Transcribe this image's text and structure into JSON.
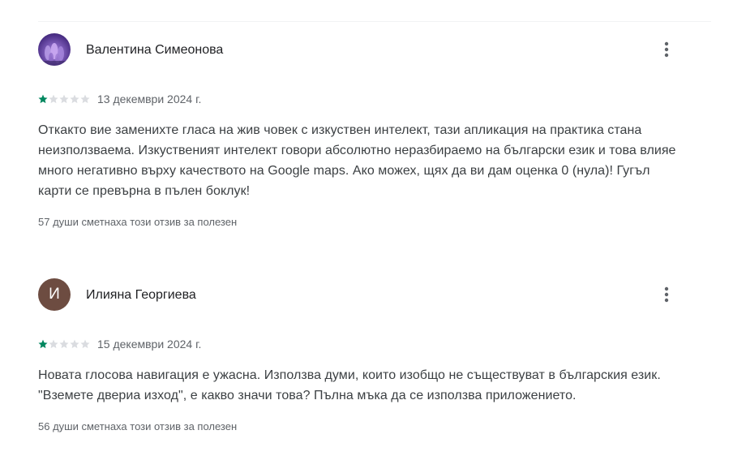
{
  "reviews": [
    {
      "author": "Валентина Симеонова",
      "avatar_type": "photo",
      "rating": 1,
      "max_rating": 5,
      "date": "13 декември 2024 г.",
      "text": "Откакто вие заменихте гласа на жив човек с изкуствен интелект, тази апликация на практика стана неизползваема. Изкуственият интелект говори абсолютно неразбираемо на български език и това влияе много негативно върху качеството на Google maps. Ако можех, щях да ви дам оценка 0 (нула)! Гугъл карти се превърна в пълен боклук!",
      "helpful": "57 души сметнаха този отзив за полезен"
    },
    {
      "author": "Илияна Георгиева",
      "avatar_type": "letter",
      "avatar_letter": "И",
      "rating": 1,
      "max_rating": 5,
      "date": "15 декември 2024 г.",
      "text": "Новата глосова навигация е ужасна. Използва думи, които изобщо не съществуват в българския език. \"Вземете двериа изход\", е какво значи това? Пълна мъка да се използва приложението.",
      "helpful": "56 души сметнаха този отзив за полезен"
    }
  ],
  "colors": {
    "star_filled": "#01875f",
    "star_empty": "#dadce0",
    "avatar_letter_bg": "#6d4c41",
    "text_primary": "#202124",
    "text_secondary": "#5f6368"
  },
  "icons": {
    "more": "more-vert-icon",
    "star": "star-icon"
  }
}
